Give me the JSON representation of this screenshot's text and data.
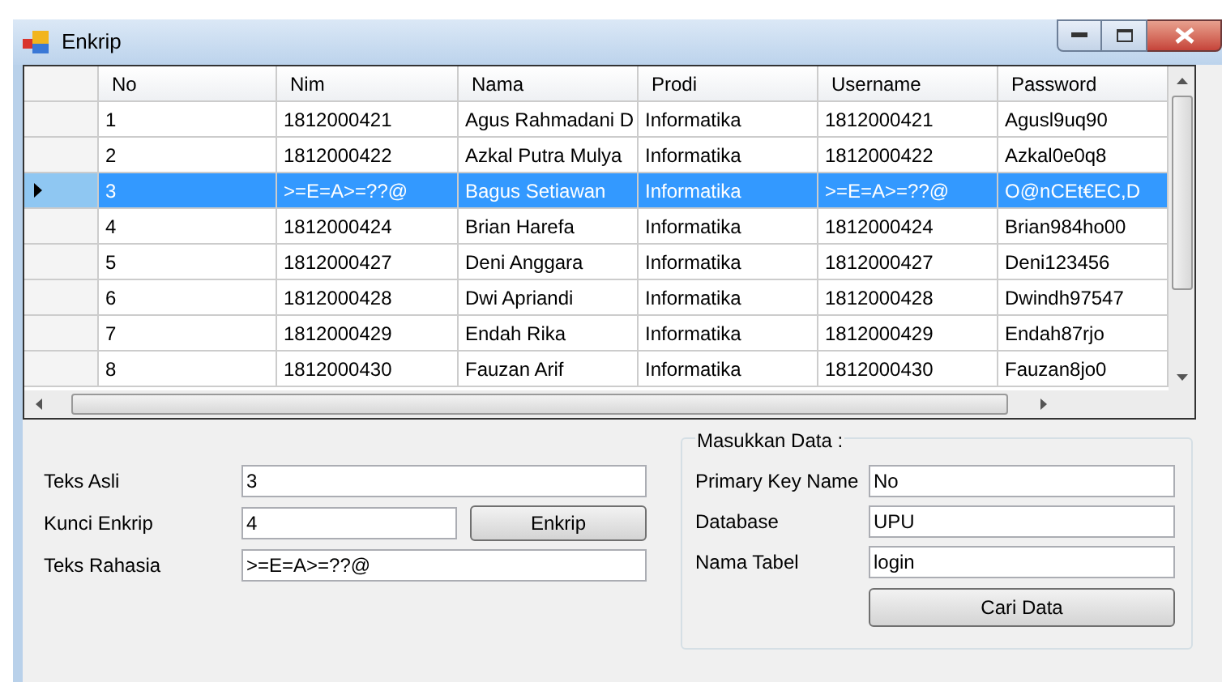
{
  "window": {
    "title": "Enkrip"
  },
  "table": {
    "columns": [
      "No",
      "Nim",
      "Nama",
      "Prodi",
      "Username",
      "Password"
    ],
    "rows": [
      {
        "cells": [
          "1",
          "1812000421",
          "Agus Rahmadani D",
          "Informatika",
          "1812000421",
          "Agusl9uq90"
        ],
        "selected": false
      },
      {
        "cells": [
          "2",
          "1812000422",
          "Azkal Putra Mulya",
          "Informatika",
          "1812000422",
          "Azkal0e0q8"
        ],
        "selected": false
      },
      {
        "cells": [
          "3",
          ">=E=A>=??@",
          "Bagus Setiawan",
          "Informatika",
          ">=E=A>=??@",
          "O@nCEt€EC,D"
        ],
        "selected": true
      },
      {
        "cells": [
          "4",
          "1812000424",
          "Brian Harefa",
          "Informatika",
          "1812000424",
          "Brian984ho00"
        ],
        "selected": false
      },
      {
        "cells": [
          "5",
          "1812000427",
          "Deni Anggara",
          "Informatika",
          "1812000427",
          "Deni123456"
        ],
        "selected": false
      },
      {
        "cells": [
          "6",
          "1812000428",
          "Dwi Apriandi",
          "Informatika",
          "1812000428",
          "Dwindh97547"
        ],
        "selected": false
      },
      {
        "cells": [
          "7",
          "1812000429",
          "Endah Rika",
          "Informatika",
          "1812000429",
          "Endah87rjo"
        ],
        "selected": false
      },
      {
        "cells": [
          "8",
          "1812000430",
          "Fauzan Arif",
          "Informatika",
          "1812000430",
          "Fauzan8jo0"
        ],
        "selected": false
      }
    ]
  },
  "form": {
    "fields": [
      {
        "label": "Teks Asli",
        "value": "3"
      },
      {
        "label": "Kunci Enkrip",
        "value": "4"
      },
      {
        "label": "Teks Rahasia",
        "value": ">=E=A>=??@"
      }
    ],
    "button": "Enkrip"
  },
  "group": {
    "title": "Masukkan Data :",
    "fields": [
      {
        "label": "Primary Key Name",
        "value": "No"
      },
      {
        "label": "Database",
        "value": "UPU"
      },
      {
        "label": "Nama Tabel",
        "value": "login"
      }
    ],
    "button": "Cari Data"
  }
}
